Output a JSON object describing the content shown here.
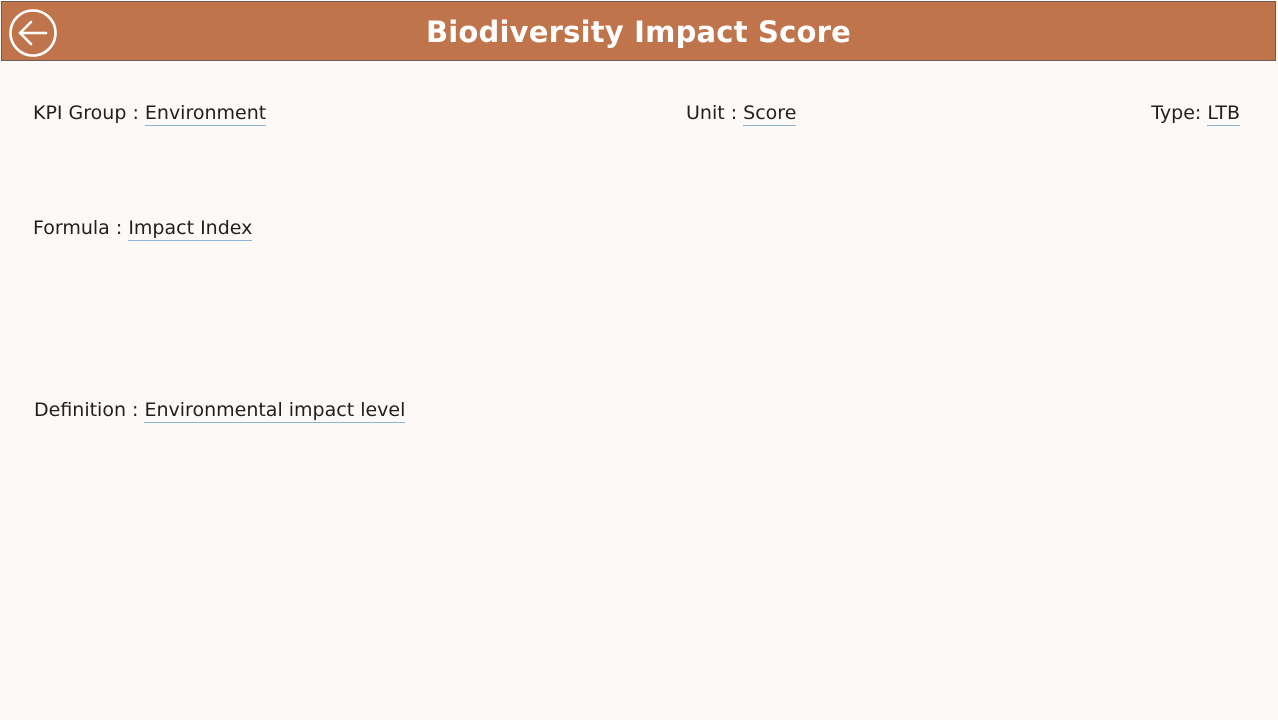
{
  "header": {
    "title": "Biodiversity Impact Score",
    "back_icon": "arrow-left-circle-icon",
    "background_color": "#c0744b"
  },
  "details": {
    "kpi_group_label": "KPI Group : ",
    "kpi_group_value": "Environment",
    "unit_label": "Unit : ",
    "unit_value": "Score",
    "type_label": "Type: ",
    "type_value": "LTB",
    "formula_label": "Formula : ",
    "formula_value": "Impact Index",
    "definition_label": "Definition : ",
    "definition_value": "Environmental impact level"
  }
}
